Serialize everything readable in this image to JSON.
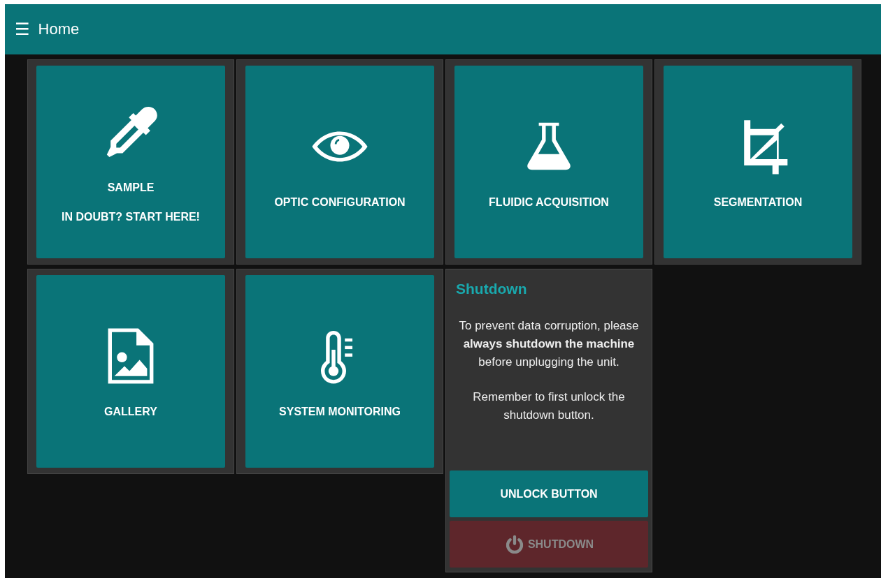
{
  "header": {
    "menu_icon": "☰",
    "title": "Home"
  },
  "tiles": [
    {
      "lines": [
        "SAMPLE",
        "IN DOUBT? START HERE!"
      ]
    },
    {
      "lines": [
        "OPTIC CONFIGURATION"
      ]
    },
    {
      "lines": [
        "FLUIDIC ACQUISITION"
      ]
    },
    {
      "lines": [
        "SEGMENTATION"
      ]
    },
    {
      "lines": [
        "GALLERY"
      ]
    },
    {
      "lines": [
        "SYSTEM MONITORING"
      ]
    }
  ],
  "shutdown_panel": {
    "title": "Shutdown",
    "paragraphs": [
      "To prevent data corruption, please **always shutdown the machine** before unplugging the unit.",
      "Remember to first unlock the shutdown button."
    ],
    "buttons": [
      {
        "kind": "unlock",
        "label": "UNLOCK BUTTON",
        "disabled": false
      },
      {
        "kind": "shutdown",
        "label": "SHUTDOWN",
        "disabled": true
      }
    ]
  }
}
